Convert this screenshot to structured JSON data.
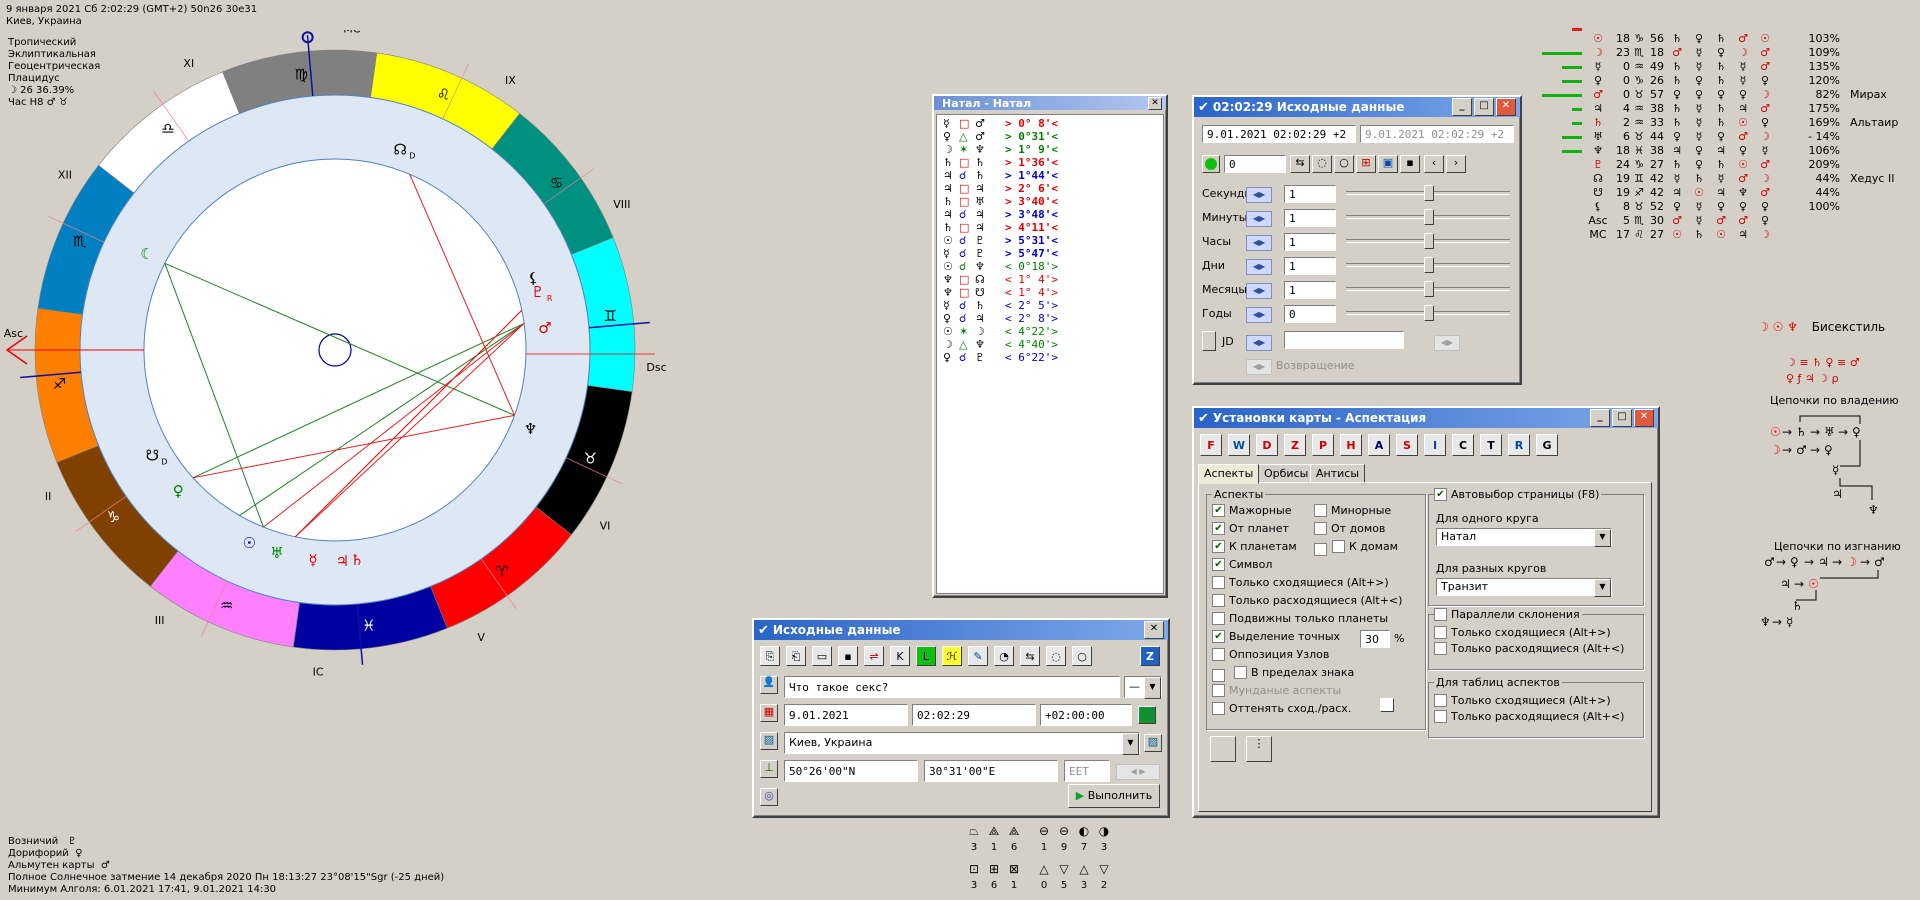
{
  "header": {
    "datetime": "9 января 2021   Сб   2:02:29 (GMT+2) 50n26  30e31",
    "place": "Киев, Украина",
    "zodiac": "Тропический",
    "ecliptic": "Эклиптикальная",
    "geo": "Геоцентрическая",
    "house_system": "Плацидус",
    "moon_day": "☽  26 36.39%",
    "hour": "Час H8  ♂ ♉"
  },
  "chart": {
    "houses": [
      "MC",
      "IX",
      "VIII",
      "Dsc",
      "VI",
      "V",
      "IC",
      "III",
      "II",
      "Asc",
      "XII",
      "XI"
    ],
    "signs": [
      "♌",
      "♋",
      "♊",
      "♉",
      "♈",
      "♓",
      "♒",
      "♑",
      "♐",
      "♏",
      "♎",
      "♍"
    ],
    "sign_colors": [
      "#ffff00",
      "#009080",
      "#00ffff",
      "#000000",
      "#ff0000",
      "#0000a0",
      "#ff80ff",
      "#804000",
      "#ff8000",
      "#0080c0",
      "#ffffff",
      "#808080"
    ],
    "planets": [
      {
        "glyph": "☊",
        "sub": "D",
        "color": "#000"
      },
      {
        "glyph": "☾",
        "color": "#008000"
      },
      {
        "glyph": "☋",
        "sub": "D",
        "color": "#000"
      },
      {
        "glyph": "♀",
        "color": "#008000"
      },
      {
        "glyph": "☉",
        "color": "#0000c0"
      },
      {
        "glyph": "♅",
        "color": "#008000"
      },
      {
        "glyph": "☿",
        "color": "#e00000"
      },
      {
        "glyph": "♃",
        "color": "#e00000"
      },
      {
        "glyph": "♄",
        "color": "#e00000"
      },
      {
        "glyph": "♆",
        "color": "#000"
      },
      {
        "glyph": "♂",
        "color": "#e00000"
      },
      {
        "glyph": "♇",
        "sub": "R",
        "color": "#e00000"
      },
      {
        "glyph": "⚸",
        "color": "#000"
      }
    ]
  },
  "natal_window": {
    "title": "Натал - Натал",
    "rows": [
      {
        "p1": "☿",
        "a": "□",
        "p2": "♂",
        "v": "> 0° 8'<",
        "c": "#e00000"
      },
      {
        "p1": "♀",
        "a": "△",
        "p2": "♂",
        "v": "> 0°31'<",
        "c": "#008000"
      },
      {
        "p1": "☽",
        "a": "✶",
        "p2": "♆",
        "v": "> 1° 9'<",
        "c": "#008000"
      },
      {
        "p1": "♄",
        "a": "□",
        "p2": "♄",
        "v": "> 1°36'<",
        "c": "#e00000"
      },
      {
        "p1": "♃",
        "a": "☌",
        "p2": "♄",
        "v": "> 1°44'<",
        "c": "#0000c0"
      },
      {
        "p1": "♃",
        "a": "□",
        "p2": "♃",
        "v": "> 2° 6'<",
        "c": "#e00000"
      },
      {
        "p1": "♄",
        "a": "□",
        "p2": "♅",
        "v": "> 3°40'<",
        "c": "#e00000"
      },
      {
        "p1": "♃",
        "a": "☌",
        "p2": "♃",
        "v": "> 3°48'<",
        "c": "#0000c0"
      },
      {
        "p1": "♄",
        "a": "□",
        "p2": "♃",
        "v": "> 4°11'<",
        "c": "#e00000"
      },
      {
        "p1": "☉",
        "a": "☌",
        "p2": "♇",
        "v": "> 5°31'<",
        "c": "#0000c0"
      },
      {
        "p1": "☿",
        "a": "☌",
        "p2": "♇",
        "v": "> 5°47'<",
        "c": "#0000c0"
      },
      {
        "p1": "☉",
        "a": "☌",
        "p2": "♆",
        "v": "< 0°18'>",
        "c": "#008000"
      },
      {
        "p1": "♆",
        "a": "□",
        "p2": "☊",
        "v": "< 1° 4'>",
        "c": "#e00000"
      },
      {
        "p1": "♆",
        "a": "□",
        "p2": "☋",
        "v": "< 1° 4'>",
        "c": "#e00000"
      },
      {
        "p1": "☿",
        "a": "☌",
        "p2": "♄",
        "v": "< 2° 5'>",
        "c": "#0000c0"
      },
      {
        "p1": "♀",
        "a": "☌",
        "p2": "♃",
        "v": "< 2° 8'>",
        "c": "#0000c0"
      },
      {
        "p1": "☉",
        "a": "✶",
        "p2": "☽",
        "v": "< 4°22'>",
        "c": "#008000"
      },
      {
        "p1": "☽",
        "a": "△",
        "p2": "♆",
        "v": "< 4°40'>",
        "c": "#008000"
      },
      {
        "p1": "♀",
        "a": "☌",
        "p2": "♇",
        "v": "< 6°22'>",
        "c": "#0000c0"
      }
    ]
  },
  "source_window": {
    "title": "02:02:29 Исходные данные",
    "current": "9.01.2021  02:02:29  +2",
    "previous": "9.01.2021  02:02:29  +2",
    "counter": "0",
    "rows": [
      {
        "label": "Секунды",
        "value": "1",
        "knob": 0.5
      },
      {
        "label": "Минуты",
        "value": "1",
        "knob": 0.5
      },
      {
        "label": "Часы",
        "value": "1",
        "knob": 0.5
      },
      {
        "label": "Дни",
        "value": "1",
        "knob": 0.5
      },
      {
        "label": "Месяцы",
        "value": "1",
        "knob": 0.5
      },
      {
        "label": "Годы",
        "value": "0",
        "knob": 0.5
      }
    ],
    "jd_label": "JD",
    "return_label": "Возвращение"
  },
  "aspect_window": {
    "title": "Установки карты - Аспектация",
    "tool_icons": [
      "F",
      "W",
      "D",
      "Z",
      "P",
      "H",
      "A",
      "S",
      "I",
      "C",
      "T",
      "R",
      "G"
    ],
    "tabs": [
      "Аспекты",
      "Орбисы",
      "Антисы"
    ],
    "group_aspects": "Аспекты",
    "checks_left": [
      {
        "label": "Мажорные",
        "on": true
      },
      {
        "label": "От планет",
        "on": true
      },
      {
        "label": "К планетам",
        "on": true
      },
      {
        "label": "Символ",
        "on": true
      },
      {
        "label": "Только сходящиеся  (Alt+>)",
        "on": false
      },
      {
        "label": "Только расходящиеся (Alt+<)",
        "on": false
      },
      {
        "label": "Подвижны только планеты",
        "on": false
      },
      {
        "label": "Выделение точных",
        "on": true
      },
      {
        "label": "Оппозиция Узлов",
        "on": false
      },
      {
        "label": "В пределах знака",
        "on": false
      },
      {
        "label": "Мунданые аспекты",
        "on": false
      },
      {
        "label": "Оттенять сход./расх.",
        "on": false
      }
    ],
    "checks_right": [
      {
        "label": "Минорные",
        "on": false
      },
      {
        "label": "От домов",
        "on": false
      },
      {
        "label": "К домам",
        "on": false
      }
    ],
    "exact_pct": "30",
    "pct": "%",
    "auto_page": "Автовыбор страницы  (F8)",
    "one_circle_label": "Для одного круга",
    "one_circle_value": "Натал",
    "diff_circle_label": "Для разных кругов",
    "diff_circle_value": "Транзит",
    "decl_group": "Параллели склонения",
    "decl_conv": "Только сходящиеся  (Alt+>)",
    "decl_div": "Только расходящиеся (Alt+<)",
    "table_group": "Для таблиц аспектов",
    "table_conv": "Только сходящиеся  (Alt+>)",
    "table_div": "Только расходящиеся (Alt+<)"
  },
  "input_window": {
    "title": "Исходные данные",
    "name": "Что такое секс?",
    "name_combo": "—",
    "date": "9.01.2021",
    "time": "02:02:29",
    "tz": "+02:00:00",
    "place": "Киев, Украина",
    "lat": "50°26'00\"N",
    "lon": "30°31'00\"E",
    "tzname": "EET",
    "run": "Выполнить"
  },
  "stats": {
    "top": [
      {
        "sym": "⏢",
        "n": "3"
      },
      {
        "sym": "⟁",
        "n": "1"
      },
      {
        "sym": "⟁",
        "n": "6"
      },
      {
        "sym": "⊖",
        "n": "1"
      },
      {
        "sym": "⊖",
        "n": "9"
      },
      {
        "sym": "◐",
        "n": "7"
      },
      {
        "sym": "◑",
        "n": "3"
      }
    ],
    "bottom": [
      {
        "sym": "⊡",
        "n": "3"
      },
      {
        "sym": "⊞",
        "n": "6"
      },
      {
        "sym": "⊠",
        "n": "1"
      },
      {
        "sym": "△",
        "n": "0"
      },
      {
        "sym": "▽",
        "n": "5"
      },
      {
        "sym": "△",
        "n": "3"
      },
      {
        "sym": "▽",
        "n": "2"
      }
    ]
  },
  "planet_table": [
    {
      "g": "☉",
      "deg": "18",
      "s": "♑",
      "min": "56",
      "r": [
        "♄",
        "♀",
        "♄",
        "♂",
        "☉"
      ],
      "pct": "103%",
      "bars": 1,
      "note": ""
    },
    {
      "g": "☽",
      "deg": "23",
      "s": "♏",
      "min": "18",
      "r": [
        "♂",
        "☿",
        "♀",
        "☽",
        "♂"
      ],
      "pct": "109%",
      "bars": 4,
      "note": ""
    },
    {
      "g": "☿",
      "deg": "0",
      "s": "♒",
      "min": "49",
      "r": [
        "♄",
        "☿",
        "♄",
        "☿",
        "♂"
      ],
      "pct": "135%",
      "bars": 2,
      "note": ""
    },
    {
      "g": "♀",
      "deg": "0",
      "s": "♑",
      "min": "26",
      "r": [
        "♄",
        "♀",
        "♄",
        "☿",
        "♀"
      ],
      "pct": "120%",
      "bars": 2,
      "note": ""
    },
    {
      "g": "♂",
      "deg": "0",
      "s": "♉",
      "min": "57",
      "r": [
        "♀",
        "♀",
        "♀",
        "♀",
        "☽"
      ],
      "pct": "82%",
      "bars": 4,
      "note": "Мирах"
    },
    {
      "g": "♃",
      "deg": "4",
      "s": "♒",
      "min": "38",
      "r": [
        "♄",
        "☿",
        "♄",
        "♃",
        "♂"
      ],
      "pct": "175%",
      "bars": 1,
      "note": ""
    },
    {
      "g": "♄",
      "deg": "2",
      "s": "♒",
      "min": "33",
      "r": [
        "♄",
        "☿",
        "♄",
        "☉",
        "♀"
      ],
      "pct": "169%",
      "bars": 1,
      "note": "Альтаир"
    },
    {
      "g": "♅",
      "deg": "6",
      "s": "♉",
      "min": "44",
      "r": [
        "♀",
        "☿",
        "♀",
        "♂",
        "☽"
      ],
      "pct": "- 14%",
      "bars": 2,
      "note": ""
    },
    {
      "g": "♆",
      "deg": "18",
      "s": "♓",
      "min": "38",
      "r": [
        "♃",
        "♀",
        "♃",
        "♀",
        "☿"
      ],
      "pct": "106%",
      "bars": 2,
      "note": ""
    },
    {
      "g": "♇",
      "deg": "24",
      "s": "♑",
      "min": "27",
      "r": [
        "♄",
        "♀",
        "♄",
        "☉",
        "♂"
      ],
      "pct": "209%",
      "bars": 0,
      "note": ""
    },
    {
      "g": "☊",
      "deg": "19",
      "s": "♊",
      "min": "42",
      "r": [
        "☿",
        "♄",
        "☿",
        "♂",
        "☽"
      ],
      "pct": "44%",
      "bars": 0,
      "note": "Хедус II"
    },
    {
      "g": "☋",
      "deg": "19",
      "s": "♐",
      "min": "42",
      "r": [
        "♃",
        "☉",
        "♃",
        "♆",
        "♂"
      ],
      "pct": "44%",
      "bars": 0,
      "note": ""
    },
    {
      "g": "⚸",
      "deg": "8",
      "s": "♉",
      "min": "52",
      "r": [
        "♀",
        "☿",
        "♀",
        "♀",
        "♀"
      ],
      "pct": "100%",
      "bars": 0,
      "note": ""
    },
    {
      "g": "Asc",
      "deg": "5",
      "s": "♏",
      "min": "30",
      "r": [
        "♂",
        "☿",
        "♂",
        "♂",
        "♀"
      ],
      "pct": "",
      "bars": 0,
      "note": ""
    },
    {
      "g": "MC",
      "deg": "17",
      "s": "♌",
      "min": "27",
      "r": [
        "☉",
        "♄",
        "☉",
        "♃",
        "☽"
      ],
      "pct": "",
      "bars": 0,
      "note": ""
    }
  ],
  "right_panel": {
    "biquintile_glyphs": "☽ ☉ ♆",
    "biquintile": "Бисекстиль",
    "dispositors": "☽ ≡ ♄ ♀ ≡ ♂",
    "dispositors2": "♀ ƒ ♃ ☽ ρ",
    "chain_rule": "Цепочки по владению",
    "chain_exile": "Цепочки по изгнанию"
  },
  "footer": {
    "line1_label": "Возничий",
    "line1_glyph": "♇",
    "line2_label": "Дорифорий",
    "line2_glyph": "♀",
    "line3_label": "Альмутен карты",
    "line3_glyph": "♂",
    "eclipse": "Полное Солнечное затмение 14 декабря 2020 Пн 18:13:27 23°08'15\"Sgr (-25 дней)",
    "algol": "Минимум Алголя: 6.01.2021 17:41,  9.01.2021 14:30"
  }
}
